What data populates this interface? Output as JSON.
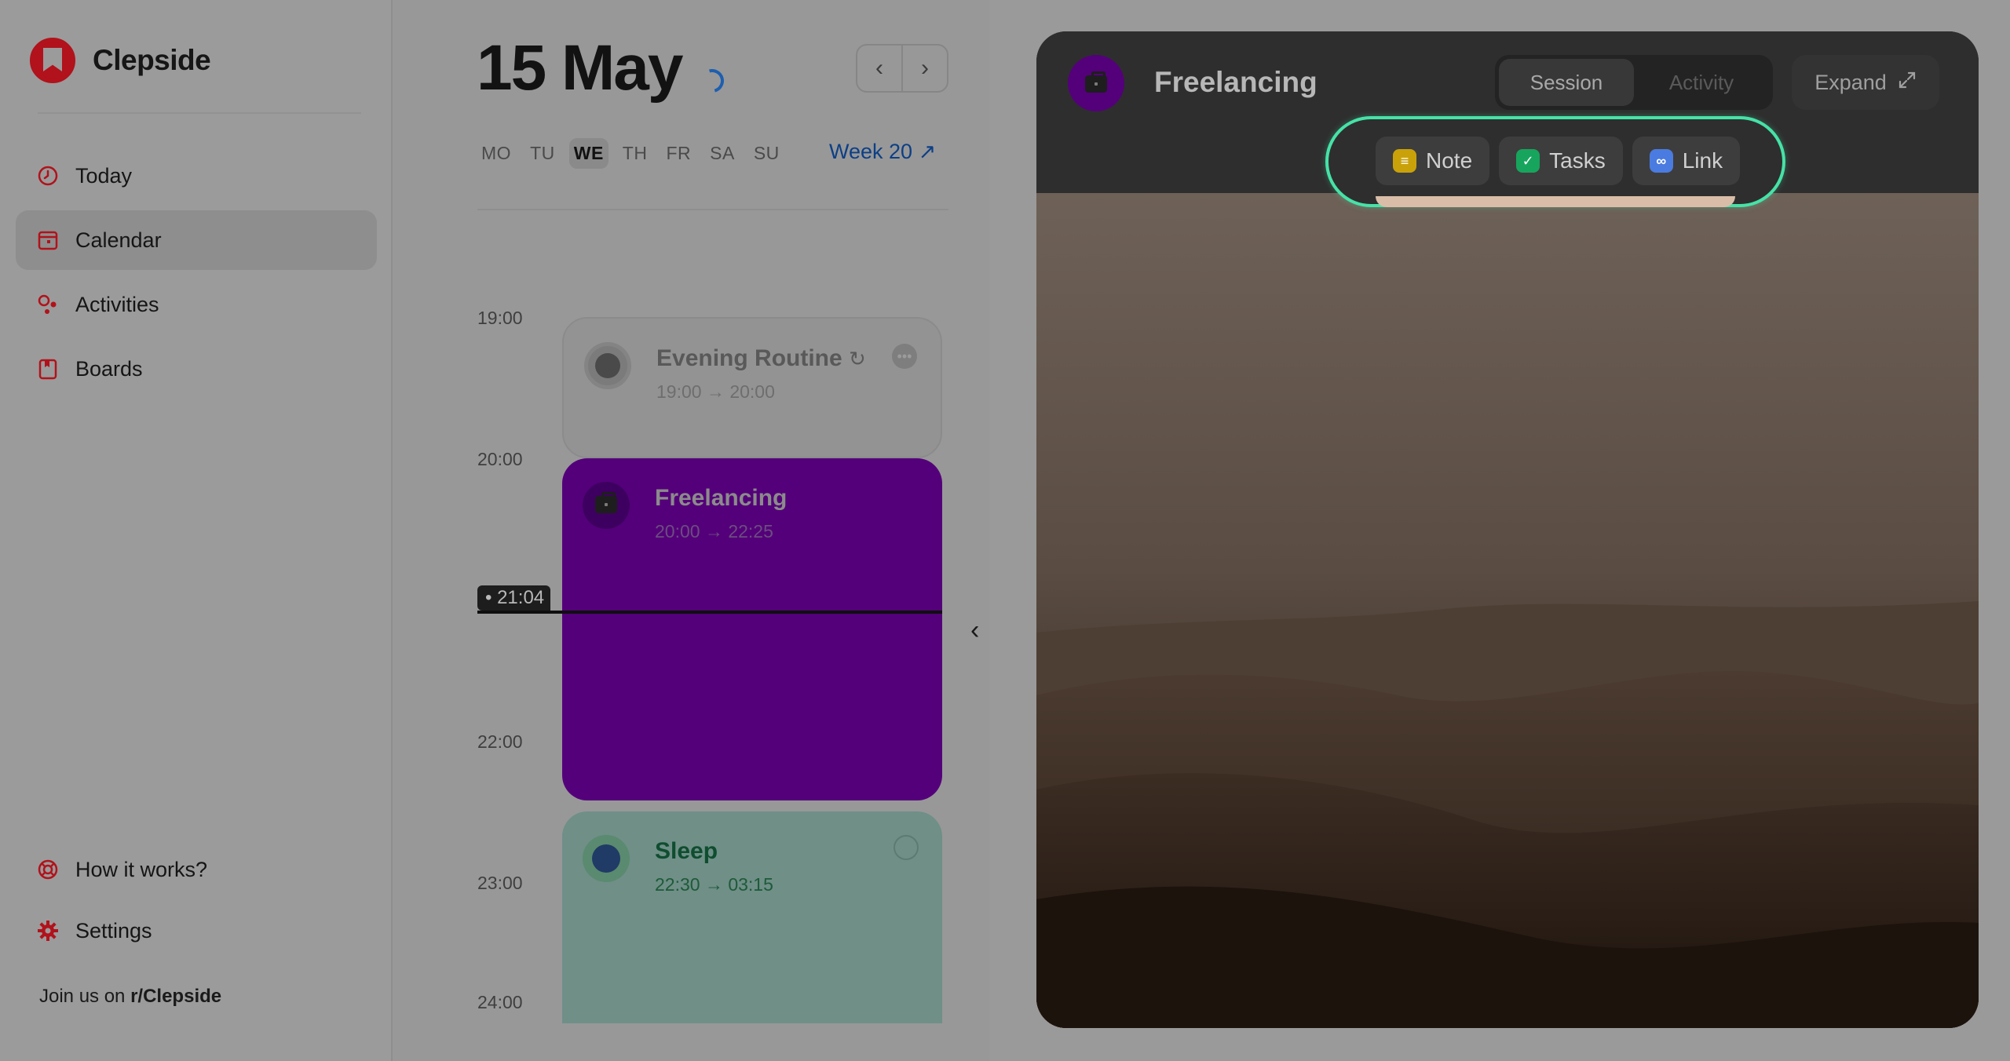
{
  "sidebar": {
    "brand": "Clepside",
    "nav": [
      {
        "label": "Today",
        "icon": "clock-icon"
      },
      {
        "label": "Calendar",
        "icon": "calendar-icon"
      },
      {
        "label": "Activities",
        "icon": "activities-icon"
      },
      {
        "label": "Boards",
        "icon": "boards-icon"
      }
    ],
    "bottom": [
      {
        "label": "How it works?",
        "icon": "lifebuoy-icon"
      },
      {
        "label": "Settings",
        "icon": "gear-icon"
      }
    ],
    "join_prefix": "Join us on ",
    "join_link": "r/Clepside"
  },
  "calendar": {
    "title": "15 May",
    "weekdays": [
      "MO",
      "TU",
      "WE",
      "TH",
      "FR",
      "SA",
      "SU"
    ],
    "current_weekday": "WE",
    "week_link": "Week 20 ↗",
    "hours": [
      "19:00",
      "20:00",
      "22:00",
      "23:00",
      "24:00"
    ],
    "now": "21:04",
    "events": [
      {
        "title": "Evening Routine",
        "time": "19:00 → 20:00",
        "repeat_icon": "↻"
      },
      {
        "title": "Freelancing",
        "time": "20:00 → 22:25"
      },
      {
        "title": "Sleep",
        "time": "22:30 → 03:15"
      }
    ]
  },
  "panel": {
    "title": "Freelancing",
    "tabs": [
      "Session",
      "Activity"
    ],
    "active_tab": "Session",
    "expand": "Expand",
    "chips": [
      {
        "label": "Note",
        "icon": "note-icon"
      },
      {
        "label": "Tasks",
        "icon": "check-icon"
      },
      {
        "label": "Link",
        "icon": "link-icon"
      }
    ]
  },
  "colors": {
    "brand_red": "#b1121b",
    "freelance_purple": "#54007a",
    "highlight_ring": "#46e2a7",
    "week_link_blue": "#0c3f86"
  }
}
